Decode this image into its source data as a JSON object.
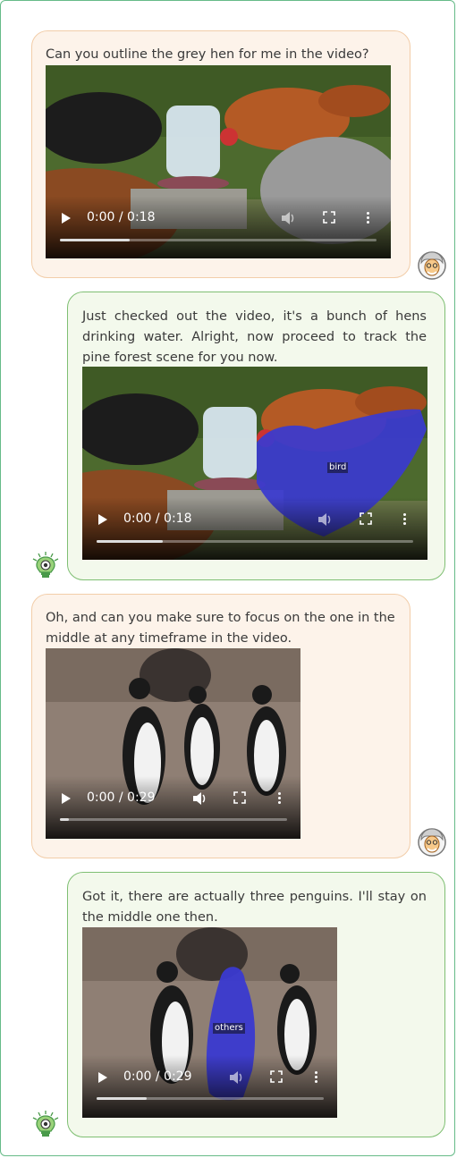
{
  "messages": [
    {
      "role": "user",
      "text": "Can you outline the grey hen for me in the video?",
      "video": {
        "time": "0:00 / 0:18",
        "progress": 0.2
      }
    },
    {
      "role": "assistant",
      "text": "Just checked out the video, it's a bunch of hens drinking water. Alright, now proceed to track the pine forest scene for you now.",
      "video": {
        "time": "0:00 / 0:18",
        "progress": 0.2,
        "mask_label": "bird"
      }
    },
    {
      "role": "user",
      "text": "Oh, and can you make sure to focus on the one in the middle at any timeframe in the video.",
      "video": {
        "time": "0:00 / 0:29",
        "progress": 0.04
      }
    },
    {
      "role": "assistant",
      "text": "Got it, there are actually three penguins. I'll stay on the middle one then.",
      "video": {
        "time": "0:00 / 0:29",
        "progress": 0.2,
        "mask_label": "others"
      }
    }
  ],
  "icons": {
    "user_avatar": "grandpa-avatar-icon",
    "bot_avatar": "lightbulb-avatar-icon",
    "play": "play-icon",
    "volume": "volume-icon",
    "fullscreen": "fullscreen-icon",
    "more": "more-options-icon"
  },
  "colors": {
    "user_bubble": "#fdf3ea",
    "bot_bubble": "#f3f9ec",
    "mask": "#3a3ad0"
  }
}
